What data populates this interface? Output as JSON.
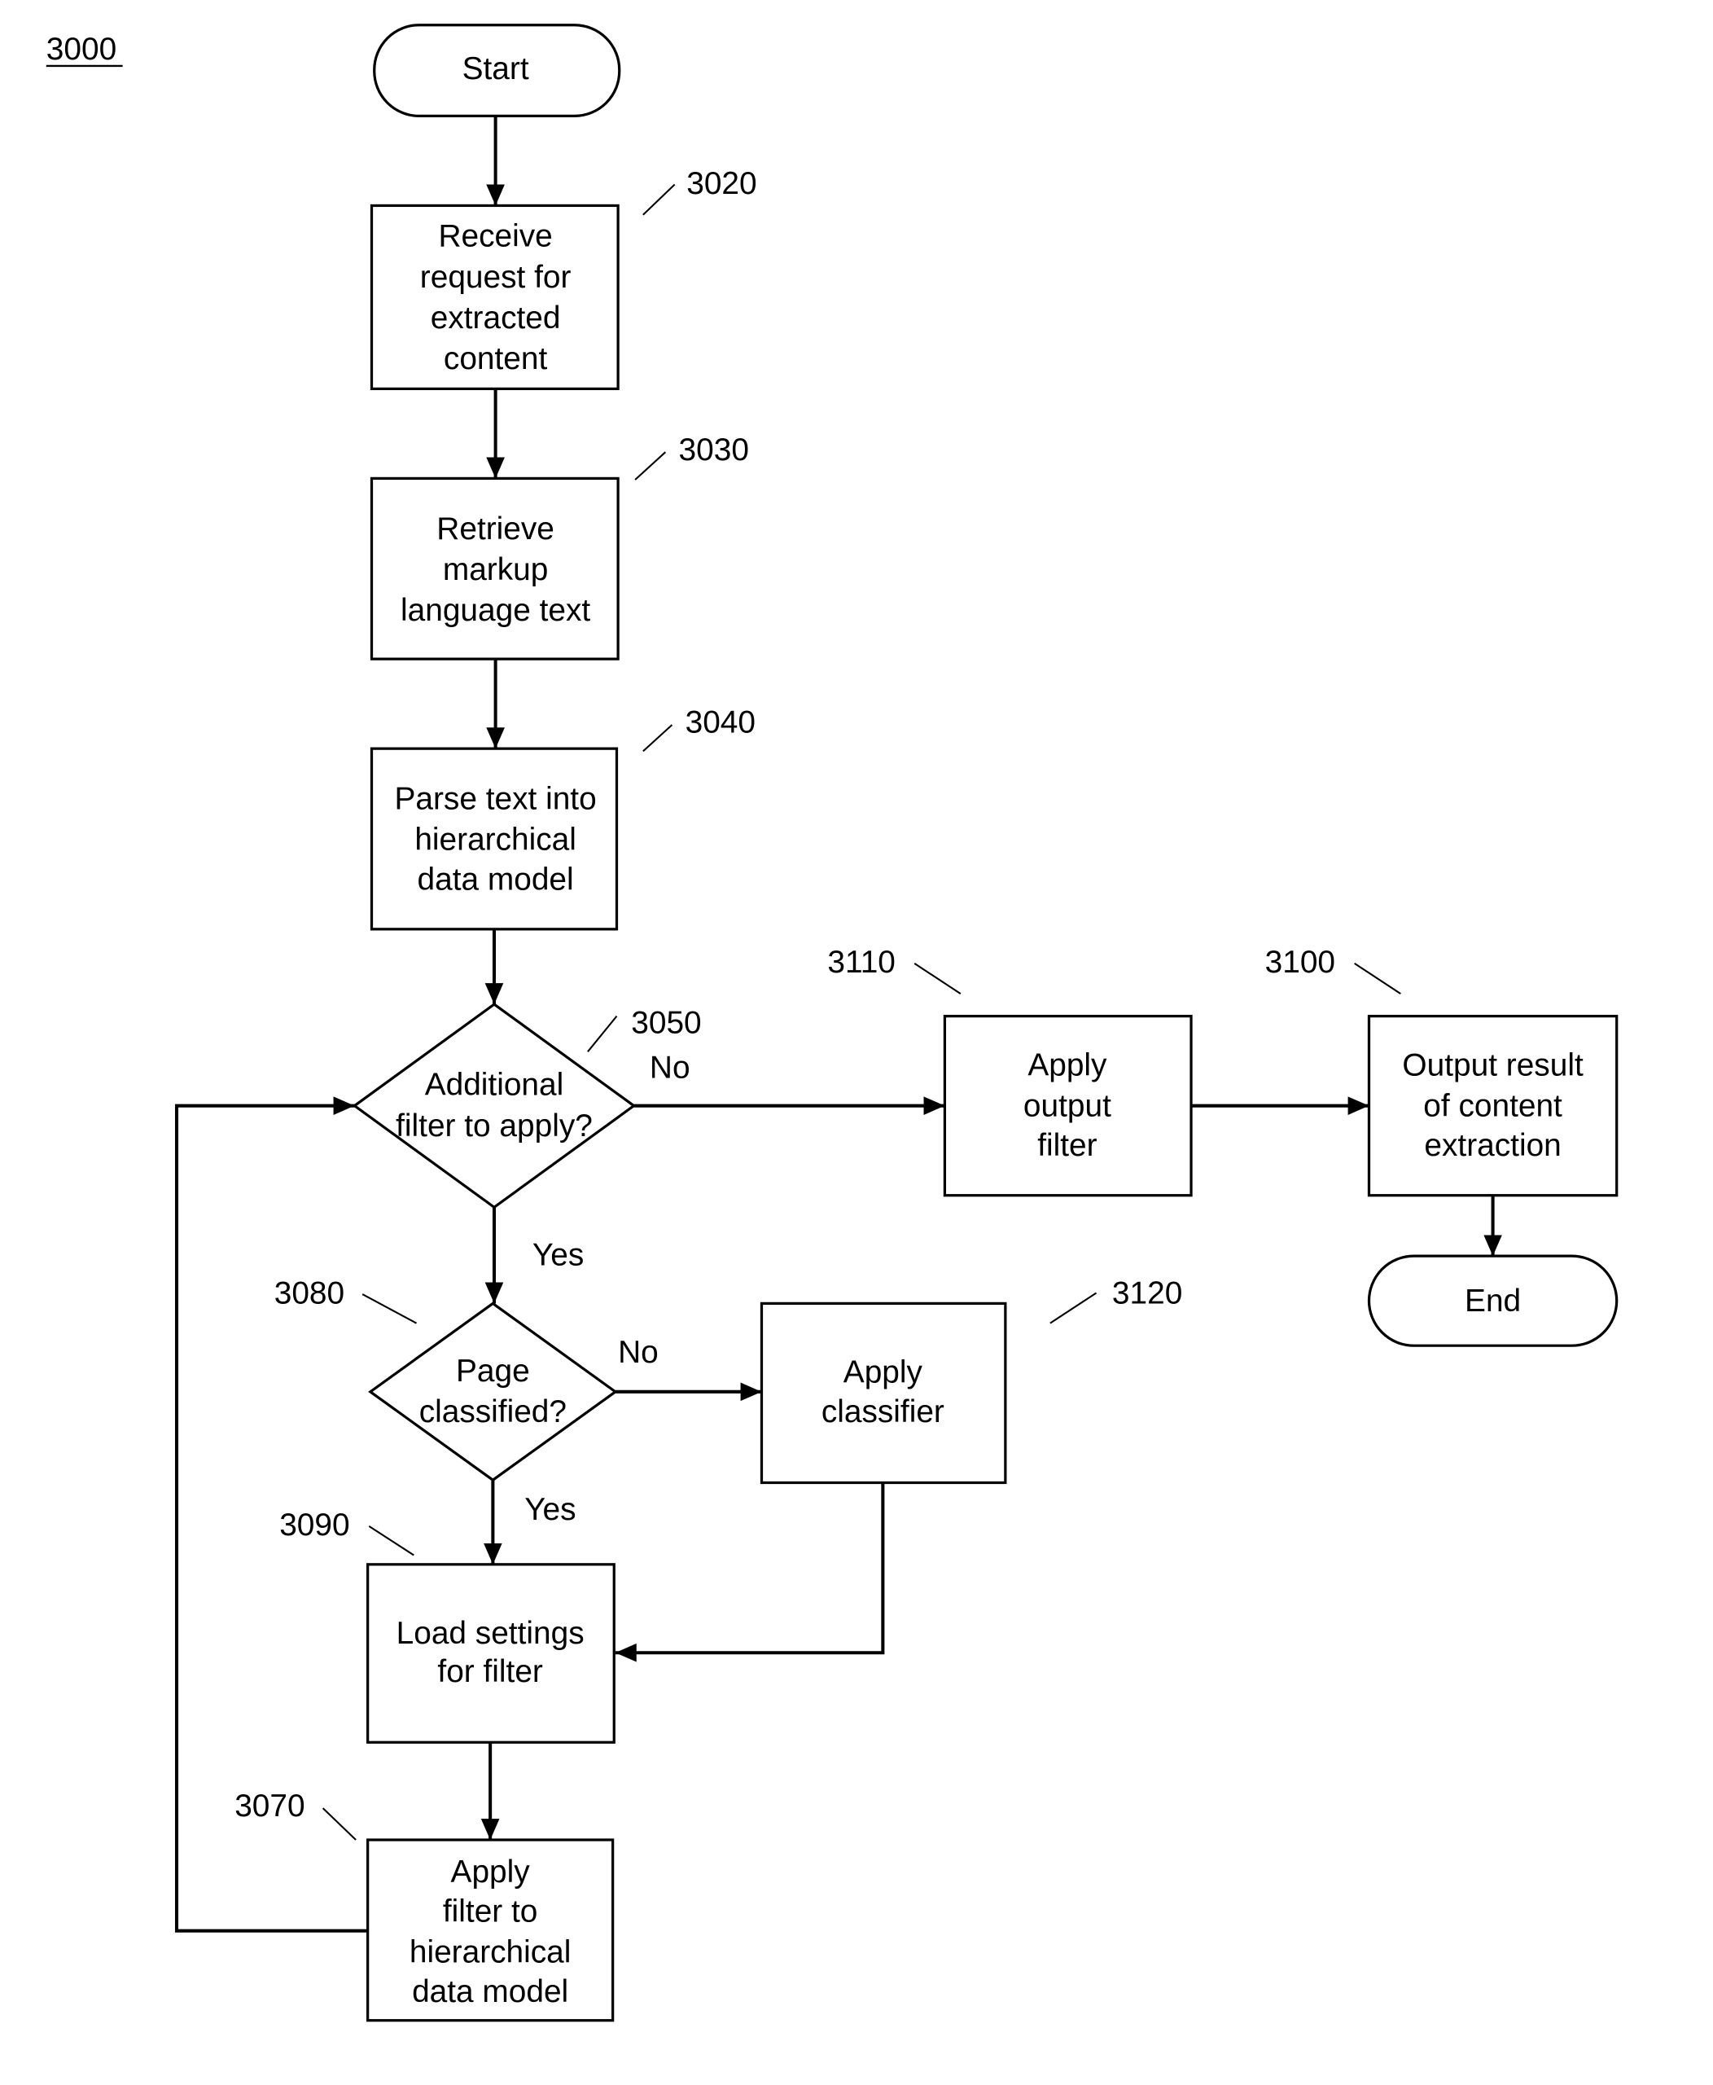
{
  "figure": {
    "number": "3000",
    "nodes": {
      "start": {
        "lines": [
          "Start"
        ]
      },
      "s3020": {
        "ref": "3020",
        "lines": [
          "Receive",
          "request for",
          "extracted",
          "content"
        ]
      },
      "s3030": {
        "ref": "3030",
        "lines": [
          "Retrieve",
          "markup",
          "language text"
        ]
      },
      "s3040": {
        "ref": "3040",
        "lines": [
          "Parse text into",
          "hierarchical",
          "data model"
        ]
      },
      "d3050": {
        "ref": "3050",
        "lines": [
          "Additional",
          "filter to apply?"
        ]
      },
      "s3110": {
        "ref": "3110",
        "lines": [
          "Apply",
          "output",
          "filter"
        ]
      },
      "s3100": {
        "ref": "3100",
        "lines": [
          "Output result",
          "of content",
          "extraction"
        ]
      },
      "end": {
        "lines": [
          "End"
        ]
      },
      "d3080": {
        "ref": "3080",
        "lines": [
          "Page",
          "classified?"
        ]
      },
      "s3120": {
        "ref": "3120",
        "lines": [
          "Apply",
          "classifier"
        ]
      },
      "s3090": {
        "ref": "3090",
        "lines": [
          "Load settings",
          "for filter"
        ]
      },
      "s3070": {
        "ref": "3070",
        "lines": [
          "Apply",
          "filter to",
          "hierarchical",
          "data model"
        ]
      }
    },
    "edge_labels": {
      "d3050_no": "No",
      "d3050_yes": "Yes",
      "d3080_no": "No",
      "d3080_yes": "Yes"
    }
  }
}
